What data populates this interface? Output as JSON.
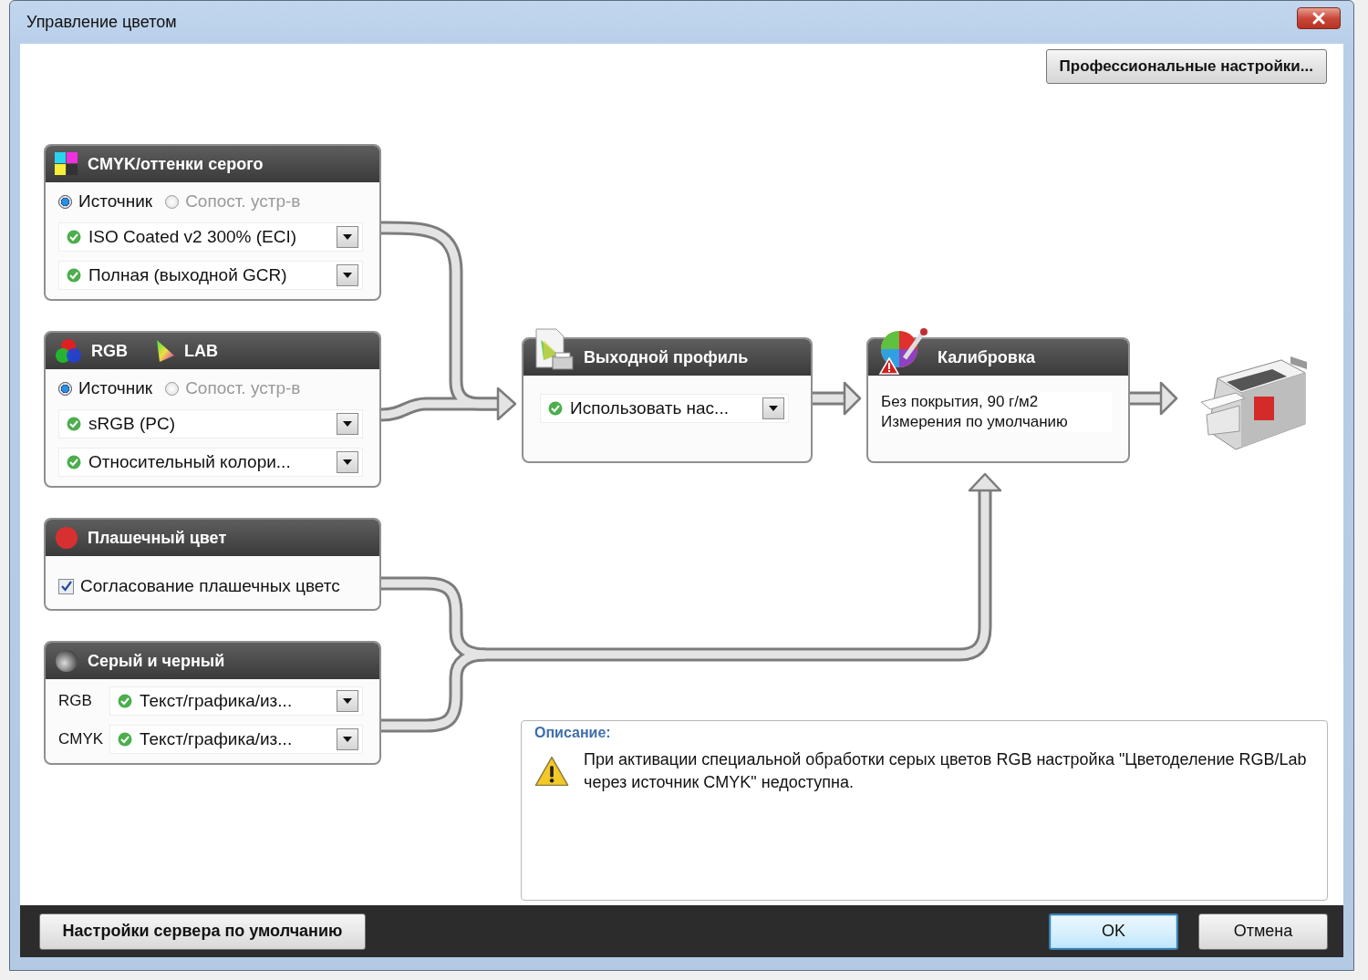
{
  "window": {
    "title": "Управление цветом"
  },
  "pro_settings_button": "Профессиональные настройки...",
  "input_panels": [
    {
      "header": [
        {
          "kind": "cmyk",
          "label": "CMYK/оттенки серого"
        }
      ],
      "radios": [
        {
          "label": "Источник",
          "selected": true,
          "disabled": false
        },
        {
          "label": "Сопост. устр-в",
          "selected": false,
          "disabled": true
        }
      ],
      "dropdowns": [
        "ISO Coated v2 300% (ECI)",
        "Полная (выходной GCR)"
      ]
    },
    {
      "header": [
        {
          "kind": "rgb",
          "label": "RGB"
        },
        {
          "kind": "lab",
          "label": "LAB"
        }
      ],
      "radios": [
        {
          "label": "Источник",
          "selected": true,
          "disabled": false
        },
        {
          "label": "Сопост. устр-в",
          "selected": false,
          "disabled": true
        }
      ],
      "dropdowns": [
        "sRGB (PC)",
        "Относительный колори..."
      ]
    },
    {
      "header": [
        {
          "kind": "spot",
          "label": "Плашечный цвет"
        }
      ],
      "checkbox": {
        "label": "Согласование плашечных цветс",
        "checked": true
      }
    },
    {
      "header": [
        {
          "kind": "gray",
          "label": "Серый и черный"
        }
      ],
      "rows": [
        {
          "label": "RGB",
          "value": "Текст/графика/из..."
        },
        {
          "label": "CMYK",
          "value": "Текст/графика/из..."
        }
      ]
    }
  ],
  "output_panel": {
    "header": [
      {
        "kind": "profile",
        "label": "Выходной профиль"
      }
    ],
    "dropdowns": [
      "Использовать нас..."
    ]
  },
  "calibration_panel": {
    "header": [
      {
        "kind": "calibration",
        "label": "Калибровка"
      }
    ],
    "lines": [
      "Без покрытия, 90 г/м2",
      "Измерения по умолчанию"
    ]
  },
  "description": {
    "label": "Описание:",
    "text": "При активации специальной обработки серых цветов RGB настройка \"Цветоделение RGB/Lab через источник CMYK\" недоступна."
  },
  "footer": {
    "reset_button": "Настройки сервера по умолчанию",
    "buttons": [
      {
        "label": "OK",
        "default": true
      },
      {
        "label": "Отмена",
        "default": false
      }
    ]
  }
}
